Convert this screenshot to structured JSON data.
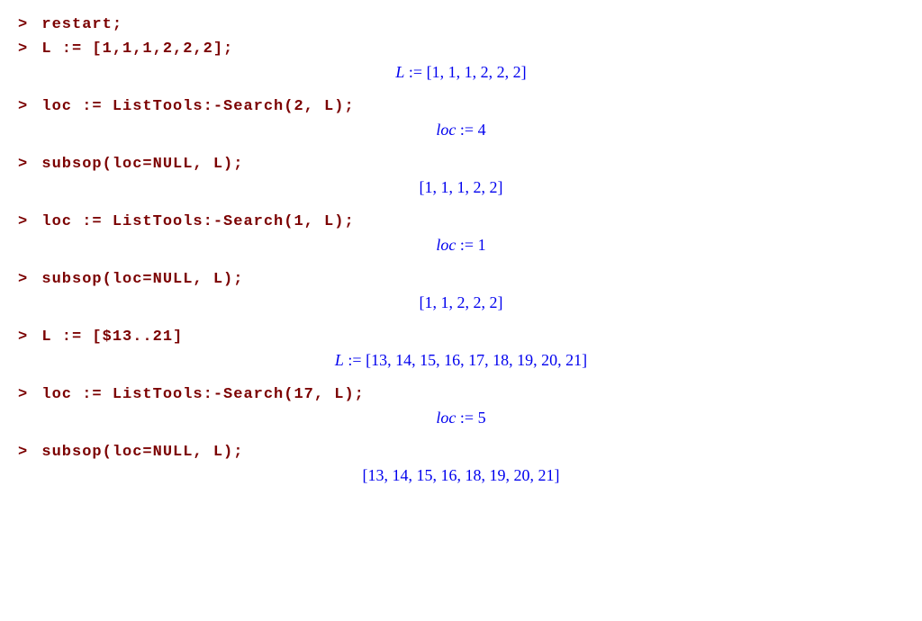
{
  "lines": [
    {
      "type": "input",
      "text": "restart;"
    },
    {
      "type": "input",
      "text": "L := [1,1,1,2,2,2];"
    },
    {
      "type": "output",
      "lhs": "L",
      "op": " := ",
      "rhs": "[1, 1, 1, 2, 2, 2]"
    },
    {
      "type": "input",
      "text": "loc := ListTools:-Search(2, L);"
    },
    {
      "type": "output",
      "lhs": "loc",
      "op": " := ",
      "rhs": "4"
    },
    {
      "type": "input",
      "text": "subsop(loc=NULL, L);"
    },
    {
      "type": "output",
      "lhs": "",
      "op": "",
      "rhs": "[1, 1, 1, 2, 2]"
    },
    {
      "type": "input",
      "text": "loc := ListTools:-Search(1, L);"
    },
    {
      "type": "output",
      "lhs": "loc",
      "op": " := ",
      "rhs": "1"
    },
    {
      "type": "input",
      "text": "subsop(loc=NULL, L);"
    },
    {
      "type": "output",
      "lhs": "",
      "op": "",
      "rhs": "[1, 1, 2, 2, 2]"
    },
    {
      "type": "input",
      "text": "L := [$13..21]"
    },
    {
      "type": "output",
      "lhs": "L",
      "op": " := ",
      "rhs": "[13, 14, 15, 16, 17, 18, 19, 20, 21]"
    },
    {
      "type": "input",
      "text": "loc := ListTools:-Search(17, L);"
    },
    {
      "type": "output",
      "lhs": "loc",
      "op": " := ",
      "rhs": "5"
    },
    {
      "type": "input",
      "text": "subsop(loc=NULL, L);"
    },
    {
      "type": "output",
      "lhs": "",
      "op": "",
      "rhs": "[13, 14, 15, 16, 18, 19, 20, 21]"
    }
  ],
  "prompt_char": ">"
}
